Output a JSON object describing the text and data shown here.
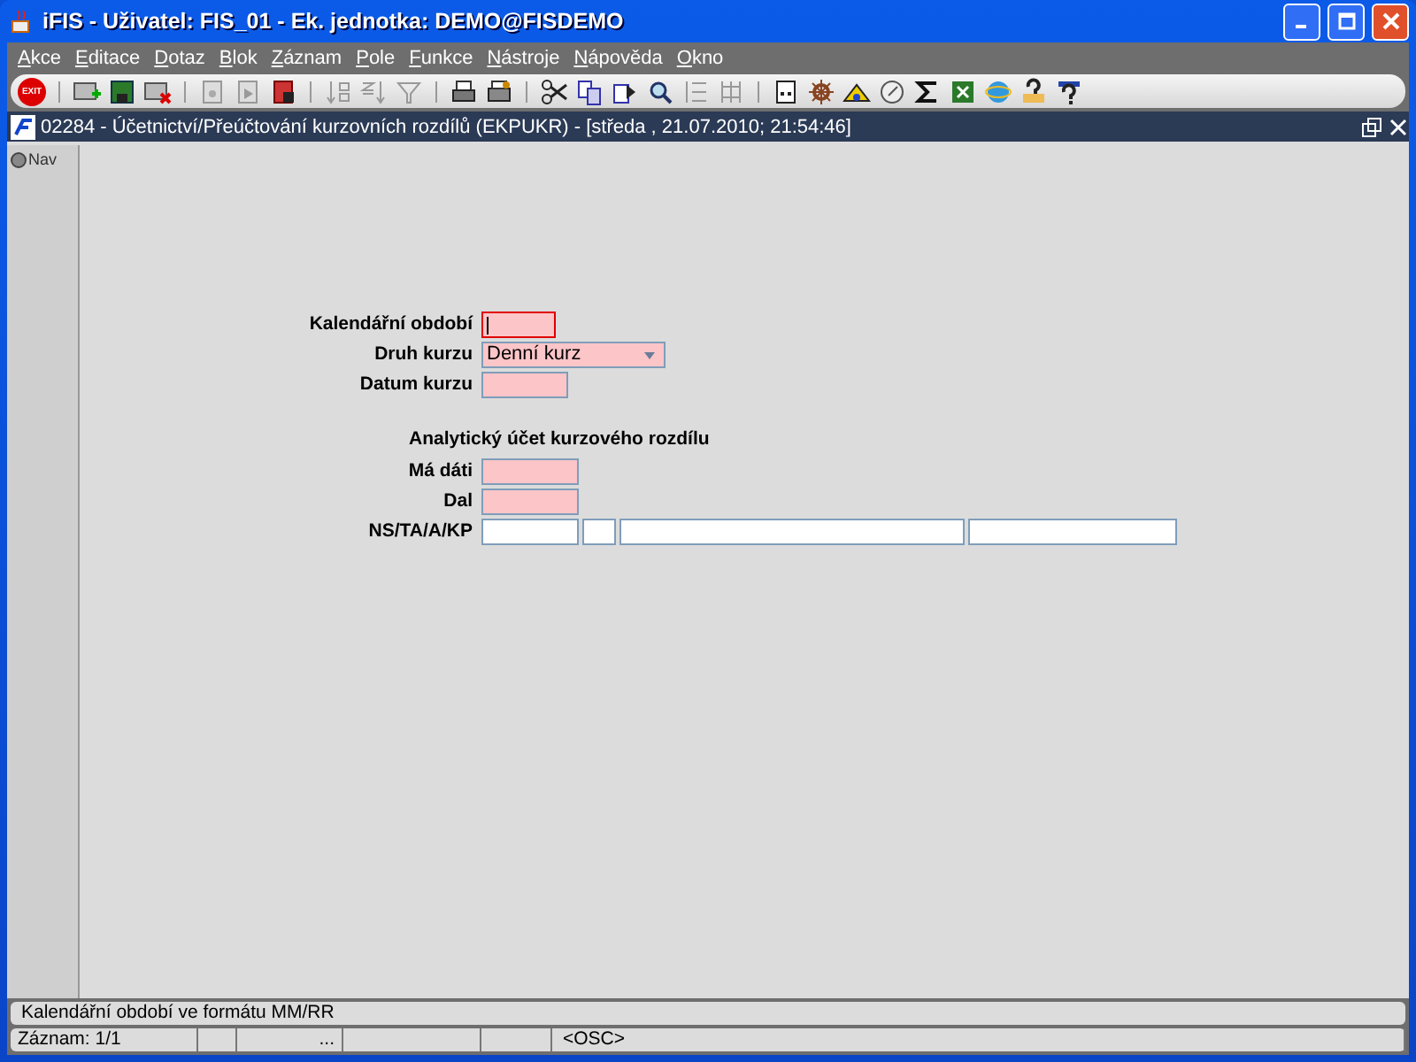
{
  "window": {
    "title": "iFIS - Uživatel: FIS_01 - Ek. jednotka: DEMO@FISDEMO"
  },
  "menu": [
    {
      "label": "Akce"
    },
    {
      "label": "Editace"
    },
    {
      "label": "Dotaz"
    },
    {
      "label": "Blok"
    },
    {
      "label": "Záznam"
    },
    {
      "label": "Pole"
    },
    {
      "label": "Funkce"
    },
    {
      "label": "Nástroje"
    },
    {
      "label": "Nápověda"
    },
    {
      "label": "Okno"
    }
  ],
  "toolbar": {
    "exit_label": "EXIT"
  },
  "document": {
    "title": "02284 - Účetnictví/Přeúčtování kurzovních rozdílů (EKPUKR) - [středa , 21.07.2010; 21:54:46]"
  },
  "nav": {
    "label": "Nav"
  },
  "form": {
    "fields": [
      {
        "kind": "text",
        "label": "Kalendářní období",
        "required": true,
        "focused": true
      },
      {
        "kind": "select",
        "label": "Druh kurzu",
        "value": "Denní kurz",
        "required": true,
        "focused": false
      },
      {
        "kind": "text",
        "label": "Datum kurzu",
        "required": true,
        "focused": false
      }
    ],
    "section_title": "Analytický účet kurzového rozdílu",
    "account_fields": [
      {
        "kind": "text",
        "label": "Má dáti",
        "required": true,
        "focused": false
      },
      {
        "kind": "text",
        "label": "Dal",
        "required": true,
        "focused": false
      },
      {
        "kind": "multi",
        "label": "NS/TA/A/KP",
        "required": false,
        "focused": false
      }
    ]
  },
  "status_bar": {
    "hint": "Kalendářní období ve formátu MM/RR",
    "record": "Záznam: 1/1",
    "ellipsis": "...",
    "mode": "<OSC>"
  }
}
